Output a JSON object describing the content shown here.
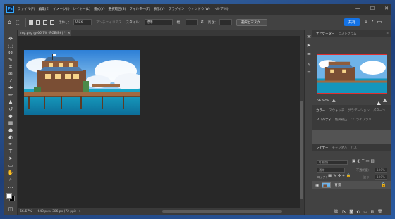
{
  "menubar": {
    "logo": "Ps",
    "items": [
      "ファイル(F)",
      "編集(E)",
      "イメージ(I)",
      "レイヤー(L)",
      "書式(Y)",
      "選択範囲(S)",
      "フィルター(T)",
      "表示(V)",
      "プラグイン",
      "ウィンドウ(W)",
      "ヘルプ(H)"
    ],
    "window_controls": [
      "—",
      "☐",
      "✕"
    ]
  },
  "options_bar": {
    "feather_label": "ぼかし：",
    "feather_value": "0 px",
    "antialias_label": "アンチエイリアス",
    "style_label": "スタイル：",
    "style_value": "標準",
    "width_label": "幅：",
    "height_label": "高さ：",
    "select_mask_button": "選択とマスク...",
    "share_button": "共有"
  },
  "document": {
    "tab_title": "img.png @ 66.7% (RGB/8#) *",
    "tab_close": "×"
  },
  "status": {
    "zoom": "66.67%",
    "info": "640 px x 386 px (72 ppi)",
    "arrow": ">"
  },
  "navigator": {
    "tabs": [
      "ナビゲーター",
      "ヒストグラム"
    ],
    "zoom": "66.67%"
  },
  "panels": {
    "group1_tabs": [
      "カラー",
      "スウォッチ",
      "グラデーション",
      "パターン"
    ],
    "group2_tabs": [
      "プロパティ",
      "色調補正",
      "CC ライブラリ"
    ],
    "layers_tabs": [
      "レイヤー",
      "チャンネル",
      "パス"
    ],
    "kind_placeholder": "Q 種類",
    "blend_mode": "通常",
    "opacity_label": "不透明度：",
    "opacity_value": "100%",
    "lock_label": "ロック：",
    "fill_label": "塗り：",
    "fill_value": "100%",
    "layer_name": "背景"
  },
  "tools": [
    "move",
    "marquee",
    "lasso",
    "quick-select",
    "crop",
    "frame",
    "eyedropper",
    "healing",
    "brush",
    "stamp",
    "history-brush",
    "eraser",
    "gradient",
    "blur",
    "dodge",
    "pen",
    "type",
    "path-select",
    "shape",
    "hand",
    "zoom",
    "more"
  ]
}
